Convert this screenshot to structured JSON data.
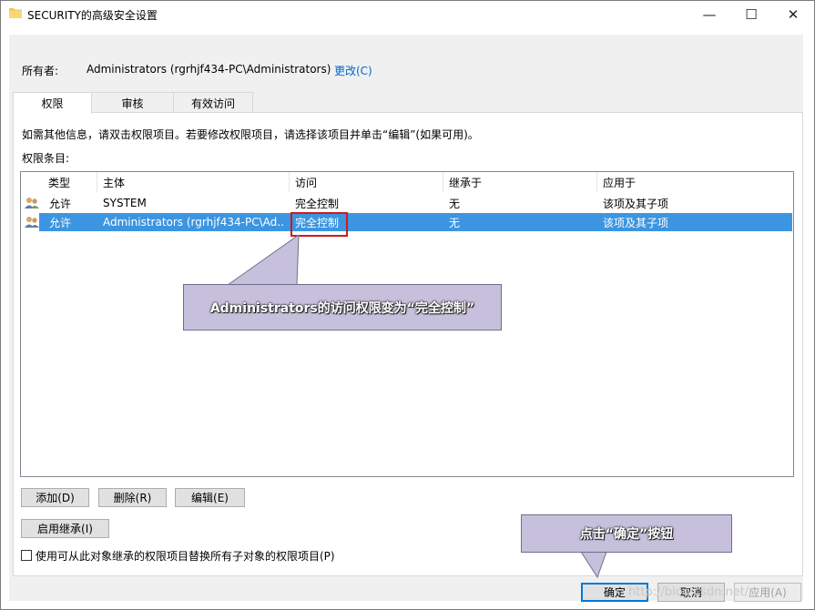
{
  "window": {
    "title": "SECURITY的高级安全设置",
    "minimize": "—",
    "maximize": "☐",
    "close": "✕"
  },
  "owner": {
    "label": "所有者:",
    "value": "Administrators (rgrhjf434-PC\\Administrators)",
    "change": "更改(C)"
  },
  "tabs": [
    {
      "label": "权限"
    },
    {
      "label": "审核"
    },
    {
      "label": "有效访问"
    }
  ],
  "info_text": "如需其他信息，请双击权限项目。若要修改权限项目，请选择该项目并单击“编辑”(如果可用)。",
  "entries_label": "权限条目:",
  "columns": [
    "类型",
    "主体",
    "访问",
    "继承于",
    "应用于"
  ],
  "rows": [
    {
      "type": "允许",
      "principal": "SYSTEM",
      "access": "完全控制",
      "inherit": "无",
      "apply": "该项及其子项"
    },
    {
      "type": "允许",
      "principal": "Administrators (rgrhjf434-PC\\Ad...",
      "access": "完全控制",
      "inherit": "无",
      "apply": "该项及其子项"
    }
  ],
  "callouts": {
    "access_note": "Administrators的访问权限变为“完全控制”",
    "ok_note": "点击“确定”按钮"
  },
  "buttons": {
    "add": "添加(D)",
    "remove": "删除(R)",
    "edit": "编辑(E)",
    "enable_inherit": "启用继承(I)",
    "ok": "确定",
    "cancel": "取消",
    "apply": "应用(A)"
  },
  "replace_checkbox_label": "使用可从此对象继承的权限项目替换所有子对象的权限项目(P)",
  "watermark": "http://blog.csdn.net/",
  "colors": {
    "selection": "#3c95e0",
    "highlight_border": "#d0191c",
    "callout_bg": "#c7c0dc",
    "link": "#0066cc"
  }
}
